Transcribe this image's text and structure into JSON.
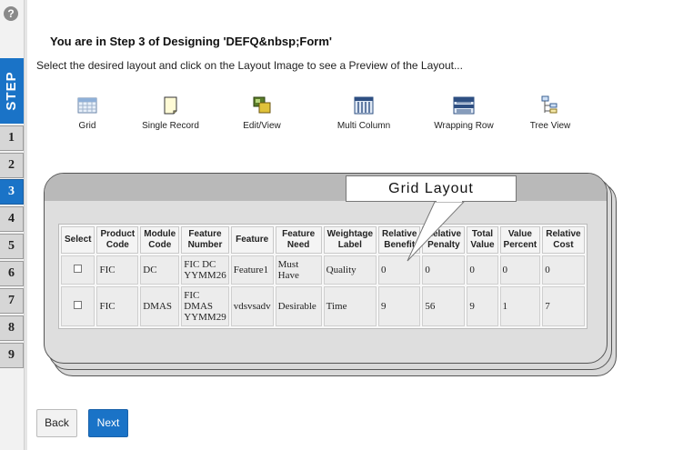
{
  "help": {
    "symbol": "?"
  },
  "step_rail": {
    "label": "STEP",
    "steps": [
      "1",
      "2",
      "3",
      "4",
      "5",
      "6",
      "7",
      "8",
      "9"
    ],
    "active_step": "3"
  },
  "header": {
    "title": "You are in Step 3 of Designing 'DEFQ&nbsp;Form'",
    "instruction": "Select the desired layout and click on the Layout Image to see a Preview of the Layout..."
  },
  "layouts": [
    {
      "label": "Grid",
      "icon": "grid-icon"
    },
    {
      "label": "Single Record",
      "icon": "single-record-icon"
    },
    {
      "label": "Edit/View",
      "icon": "edit-view-icon"
    },
    {
      "label": "Multi Column",
      "icon": "multi-column-icon"
    },
    {
      "label": "Wrapping Row",
      "icon": "wrapping-row-icon"
    },
    {
      "label": "Tree View",
      "icon": "tree-view-icon"
    }
  ],
  "preview": {
    "callout_label": "Grid Layout",
    "columns": [
      [
        "Select"
      ],
      [
        "Product",
        "Code"
      ],
      [
        "Module",
        "Code"
      ],
      [
        "Feature",
        "Number"
      ],
      [
        "Feature"
      ],
      [
        "Feature",
        "Need"
      ],
      [
        "Weightage",
        "Label"
      ],
      [
        "Relative",
        "Benefit"
      ],
      [
        "Relative",
        "Penalty"
      ],
      [
        "Total",
        "Value"
      ],
      [
        "Value",
        "Percent"
      ],
      [
        "Relative",
        "Cost"
      ]
    ],
    "rows": [
      {
        "product_code": "FIC",
        "module_code": "DC",
        "feature_number": [
          "FIC DC",
          "YYMM26"
        ],
        "feature": "Feature1",
        "feature_need": "Must Have",
        "weightage_label": "Quality",
        "relative_benefit": "0",
        "relative_penalty": "0",
        "total_value": "0",
        "value_percent": "0",
        "relative_cost": "0"
      },
      {
        "product_code": "FIC",
        "module_code": "DMAS",
        "feature_number": [
          "FIC",
          "DMAS",
          "YYMM29"
        ],
        "feature": "vdsvsadv",
        "feature_need": "Desirable",
        "weightage_label": "Time",
        "relative_benefit": "9",
        "relative_penalty": "56",
        "total_value": "9",
        "value_percent": "1",
        "relative_cost": "7"
      }
    ]
  },
  "buttons": {
    "back": "Back",
    "next": "Next"
  },
  "colors": {
    "accent": "#1a73c7",
    "card": "#dedede",
    "card_band": "#b9b9b9"
  }
}
